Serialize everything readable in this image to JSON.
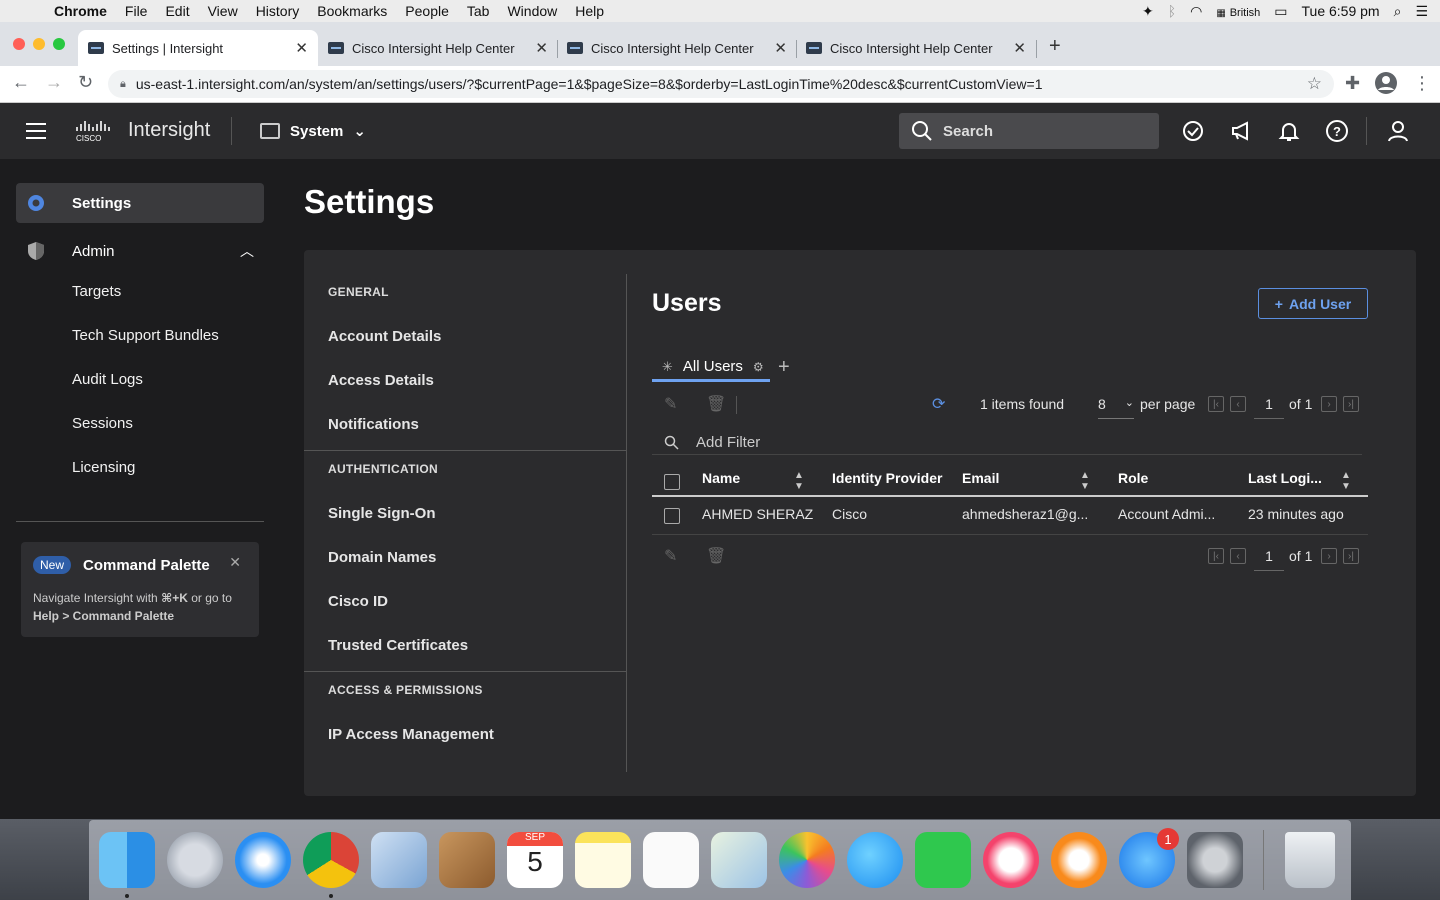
{
  "menubar": {
    "app": "Chrome",
    "items": [
      "File",
      "Edit",
      "View",
      "History",
      "Bookmarks",
      "People",
      "Tab",
      "Window",
      "Help"
    ],
    "input_source": "British",
    "clock": "Tue 6:59 pm"
  },
  "tabs": [
    {
      "title": "Settings | Intersight",
      "active": true
    },
    {
      "title": "Cisco Intersight Help Center",
      "active": false
    },
    {
      "title": "Cisco Intersight Help Center",
      "active": false
    },
    {
      "title": "Cisco Intersight Help Center",
      "active": false
    }
  ],
  "address": {
    "url": "us-east-1.intersight.com/an/system/an/settings/users/?$currentPage=1&$pageSize=8&$orderby=LastLoginTime%20desc&$currentCustomView=1"
  },
  "header": {
    "brand": "Intersight",
    "logo_text": "CISCO",
    "scope": "System",
    "search_placeholder": "Search"
  },
  "sidebar": {
    "settings": "Settings",
    "admin": "Admin",
    "admin_items": [
      "Targets",
      "Tech Support Bundles",
      "Audit Logs",
      "Sessions",
      "Licensing"
    ],
    "command_card": {
      "badge": "New",
      "title": "Command Palette",
      "desc_prefix": "Navigate Intersight with ",
      "shortcut": "⌘+K",
      "desc_mid": " or go to ",
      "desc_path": "Help > Command Palette"
    }
  },
  "page": {
    "title": "Settings"
  },
  "settings_menu": {
    "general_heading": "GENERAL",
    "general": [
      "Account Details",
      "Access Details",
      "Notifications"
    ],
    "auth_heading": "AUTHENTICATION",
    "auth": [
      "Single Sign-On",
      "Domain Names",
      "Cisco ID",
      "Trusted Certificates"
    ],
    "access_heading": "ACCESS & PERMISSIONS",
    "access": [
      "IP Access Management"
    ]
  },
  "users": {
    "title": "Users",
    "add_button": "Add User",
    "view_tab": "All Users",
    "items_found": "1 items found",
    "page_size": "8",
    "per_page": "per page",
    "current_page": "1",
    "of_pages": "of 1",
    "filter_placeholder": "Add Filter",
    "columns": [
      "Name",
      "Identity Provider",
      "Email",
      "Role",
      "Last Logi..."
    ],
    "rows": [
      {
        "name": "AHMED SHERAZ",
        "idp": "Cisco",
        "email": "ahmedsheraz1@g...",
        "role": "Account Admi...",
        "last_login": "23 minutes ago"
      }
    ]
  },
  "dock": {
    "calendar_month": "SEP",
    "calendar_day": "5",
    "appstore_badge": "1"
  },
  "colors": {
    "accent": "#6ea2f0",
    "header_bg": "#2b2b2d",
    "page_bg": "#1c1c1e"
  }
}
